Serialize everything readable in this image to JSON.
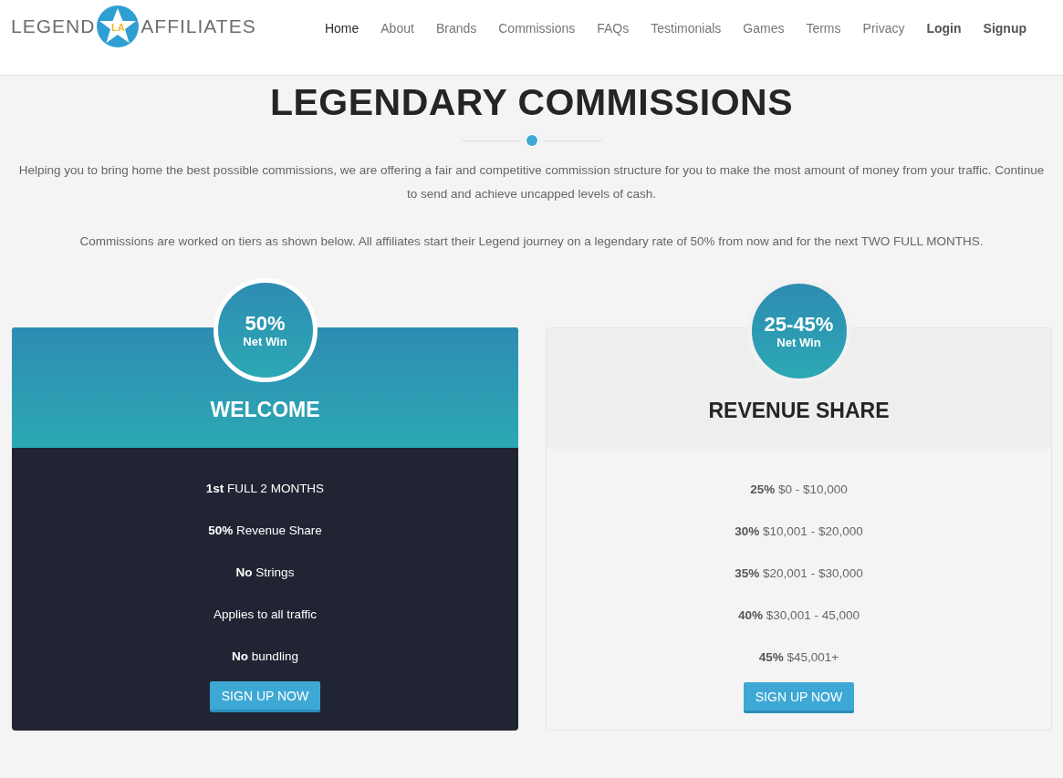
{
  "logo": {
    "left": "LEGEND",
    "badge": "LA",
    "right": "AFFILIATES"
  },
  "nav": [
    {
      "label": "Home",
      "kind": "link",
      "selected": true
    },
    {
      "label": "About",
      "kind": "link",
      "selected": false
    },
    {
      "label": "Brands",
      "kind": "link",
      "selected": false
    },
    {
      "label": "Commissions",
      "kind": "link",
      "selected": false
    },
    {
      "label": "FAQs",
      "kind": "link",
      "selected": false
    },
    {
      "label": "Testimonials",
      "kind": "link",
      "selected": false
    },
    {
      "label": "Games",
      "kind": "link",
      "selected": false
    },
    {
      "label": "Terms",
      "kind": "link",
      "selected": false
    },
    {
      "label": "Privacy",
      "kind": "link",
      "selected": false
    },
    {
      "label": "Login",
      "kind": "account",
      "selected": false
    },
    {
      "label": "Signup",
      "kind": "account",
      "selected": false
    }
  ],
  "heading": "LEGENDARY COMMISSIONS",
  "intro": [
    "Helping you to bring home the best possible commissions, we are offering a fair and competitive commission structure for you to make the most amount of money from your traffic. Continue to send and achieve uncapped levels of cash.",
    "Commissions are worked on tiers as shown below. All affiliates start their Legend journey on a legendary rate of 50% from now and for the next TWO FULL MONTHS."
  ],
  "plans": [
    {
      "kind": "featured",
      "rate": "50%",
      "rate_label": "Net Win",
      "title": "WELCOME",
      "features": [
        "**1st** FULL 2 MONTHS",
        "**50%** Revenue Share",
        "**No** Strings",
        "Applies to all traffic",
        "**No** bundling"
      ],
      "button": "SIGN UP NOW"
    },
    {
      "kind": "standard",
      "rate": "25-45%",
      "rate_label": "Net Win",
      "title": "REVENUE SHARE",
      "features": [
        "**25%** $0 - $10,000",
        "**30%** $10,001 - $20,000",
        "**35%** $20,001 - $30,000",
        "**40%** $30,001 - 45,000",
        "**45%** $45,001+"
      ],
      "button": "SIGN UP NOW"
    }
  ]
}
